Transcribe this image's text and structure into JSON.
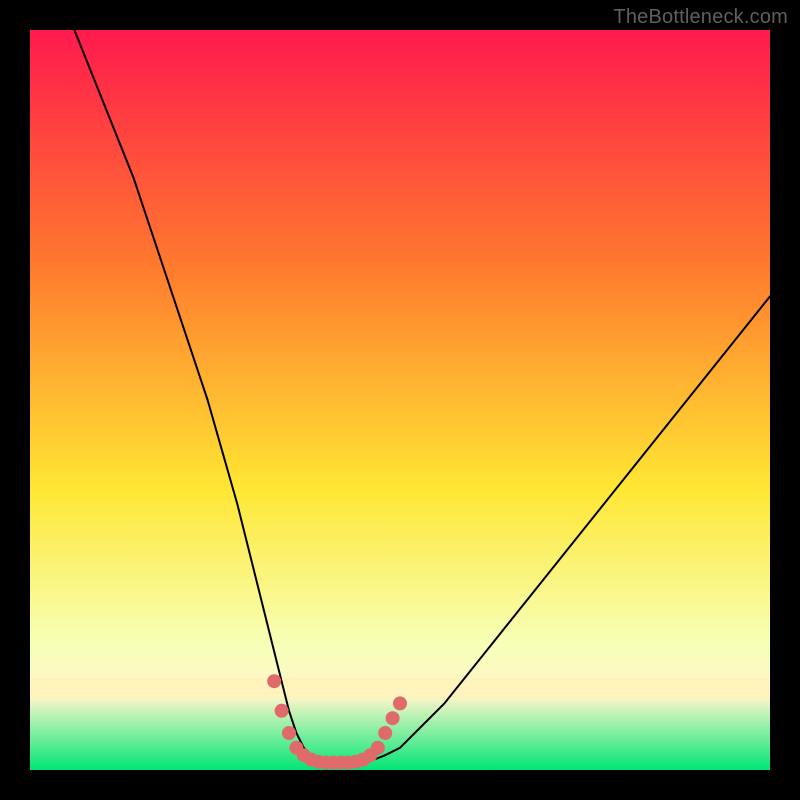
{
  "watermark": "TheBottleneck.com",
  "chart_data": {
    "type": "line",
    "title": "",
    "xlabel": "",
    "ylabel": "",
    "xlim": [
      0,
      100
    ],
    "ylim": [
      0,
      100
    ],
    "background_gradient": {
      "top": "#ff1a4d",
      "mid_upper": "#ff7a2e",
      "mid": "#ffe733",
      "mid_lower": "#f7ffb8",
      "base_highlight": "#fff6c9",
      "bottom": "#00e676"
    },
    "series": [
      {
        "name": "bottleneck-curve",
        "color": "#000000",
        "x": [
          6,
          8,
          10,
          12,
          14,
          16,
          18,
          20,
          22,
          24,
          26,
          28,
          30,
          31,
          32,
          33,
          34,
          35,
          36,
          37,
          38,
          39,
          40,
          42,
          44,
          46,
          48,
          50,
          52,
          56,
          60,
          64,
          68,
          72,
          76,
          80,
          84,
          88,
          92,
          96,
          100
        ],
        "y": [
          100,
          95,
          90,
          85,
          80,
          74,
          68,
          62,
          56,
          50,
          43,
          36,
          28,
          24,
          20,
          16,
          12,
          8,
          5,
          3,
          2,
          1.2,
          1,
          1,
          1,
          1.2,
          2,
          3,
          5,
          9,
          14,
          19,
          24,
          29,
          34,
          39,
          44,
          49,
          54,
          59,
          64
        ]
      }
    ],
    "valley_marker": {
      "name": "optimal-range",
      "color": "#e06a6a",
      "x": [
        33,
        34,
        35,
        36,
        37,
        38,
        39,
        40,
        41,
        42,
        43,
        44,
        45,
        46,
        47,
        48,
        49,
        50
      ],
      "y": [
        12,
        8,
        5,
        3,
        2,
        1.4,
        1.1,
        1,
        1,
        1,
        1,
        1.1,
        1.4,
        2,
        3,
        5,
        7,
        9
      ]
    }
  }
}
